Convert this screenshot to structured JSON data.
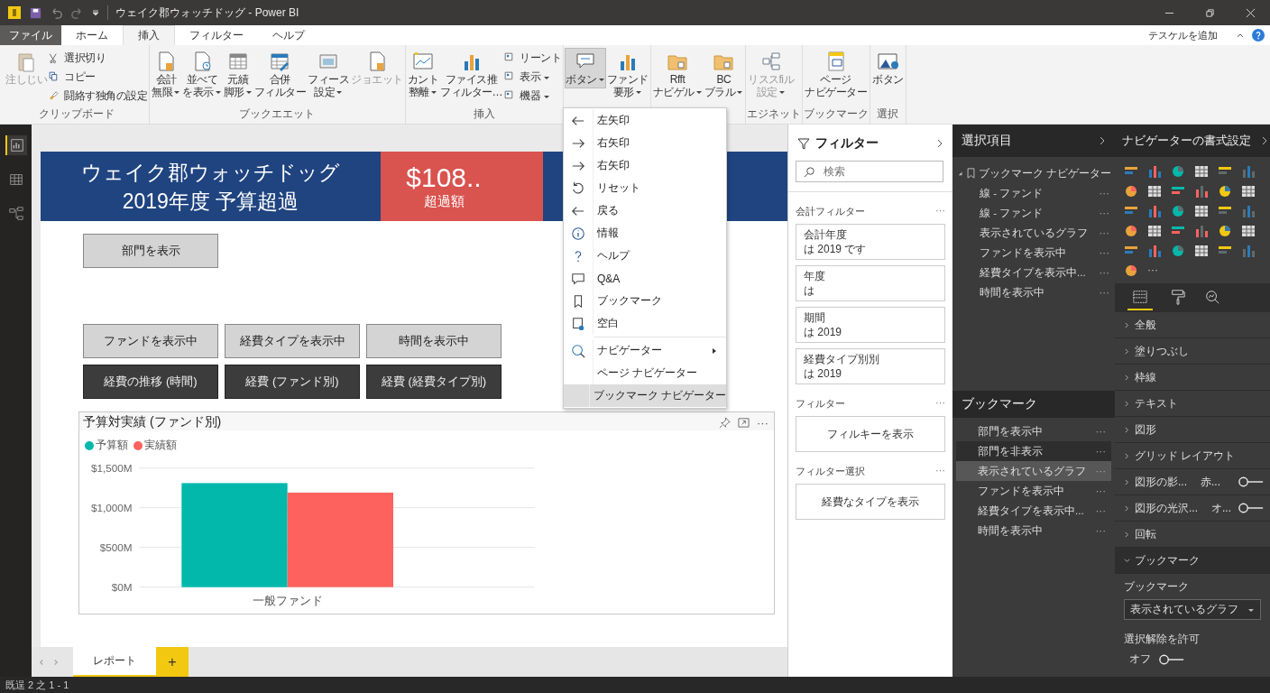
{
  "window": {
    "title": "ウェイク郡ウォッチドッグ - Power BI"
  },
  "tabs": [
    {
      "label": "ファイル",
      "kind": "file",
      "selected": false
    },
    {
      "label": "ホーム",
      "kind": "tab",
      "selected": false
    },
    {
      "label": "挿入",
      "kind": "tab",
      "selected": true
    },
    {
      "label": "フィルター",
      "kind": "tab",
      "selected": false
    },
    {
      "label": "ヘルプ",
      "kind": "tab",
      "selected": false
    }
  ],
  "tab_bar_link": "テスケルを追加",
  "ribbon_groups": [
    {
      "label": "クリップボード",
      "items": [
        {
          "kind": "large",
          "lines": [
            "注しじい"
          ],
          "dropdown": false,
          "disabled": true,
          "pressed": false
        },
        {
          "kind": "stack",
          "entries": [
            {
              "label": "選択切り",
              "dropdown": false
            },
            {
              "label": "コピー",
              "dropdown": false
            },
            {
              "label": "闘絡す独角の設定",
              "dropdown": false
            }
          ]
        }
      ]
    },
    {
      "label": "ブックエエット",
      "items": [
        {
          "kind": "large",
          "lines": [
            "会計",
            "無限"
          ],
          "dropdown": true,
          "disabled": false,
          "pressed": false
        },
        {
          "kind": "large",
          "lines": [
            "並べて",
            "を表示"
          ],
          "dropdown": true,
          "disabled": false,
          "pressed": false
        },
        {
          "kind": "large",
          "lines": [
            "元績",
            "脚形"
          ],
          "dropdown": true,
          "disabled": false,
          "pressed": false
        },
        {
          "kind": "large",
          "lines": [
            "合併",
            "フィルター"
          ],
          "dropdown": false,
          "disabled": false,
          "pressed": false
        },
        {
          "kind": "large",
          "lines": [
            "フィース",
            "設定"
          ],
          "dropdown": true,
          "disabled": false,
          "pressed": false
        },
        {
          "kind": "large",
          "lines": [
            "ジョエット"
          ],
          "dropdown": false,
          "disabled": true,
          "pressed": false
        }
      ]
    },
    {
      "label": "挿入",
      "items": [
        {
          "kind": "large",
          "lines": [
            "カント",
            "整離"
          ],
          "dropdown": true,
          "disabled": false,
          "pressed": false
        },
        {
          "kind": "large",
          "lines": [
            "ファイス推",
            "フィルター…"
          ],
          "dropdown": false,
          "disabled": false,
          "pressed": false
        },
        {
          "kind": "stack",
          "entries": [
            {
              "label": "リーント",
              "dropdown": false
            },
            {
              "label": "表示",
              "dropdown": true
            },
            {
              "label": "機器",
              "dropdown": true
            }
          ]
        }
      ]
    },
    {
      "items": [
        {
          "kind": "large",
          "lines": [
            "ボタン"
          ],
          "dropdown": true,
          "disabled": false,
          "pressed": true
        },
        {
          "kind": "large",
          "lines": [
            "ファンド",
            "要形"
          ],
          "dropdown": true,
          "disabled": false,
          "pressed": false
        }
      ]
    },
    {
      "items": [
        {
          "kind": "large",
          "lines": [
            "Rfft",
            "ナビゲル"
          ],
          "dropdown": true,
          "disabled": false,
          "pressed": false
        },
        {
          "kind": "large",
          "lines": [
            "BC",
            "ブラル"
          ],
          "dropdown": true,
          "disabled": false,
          "pressed": false
        }
      ]
    },
    {
      "label": "エジネット",
      "items": [
        {
          "kind": "large",
          "lines": [
            "リススfiル",
            "設定"
          ],
          "dropdown": true,
          "disabled": true,
          "pressed": false
        }
      ]
    },
    {
      "label": "ブックマーク",
      "items": [
        {
          "kind": "large",
          "lines": [
            "ページ",
            "ナビゲーター"
          ],
          "dropdown": false,
          "disabled": false,
          "pressed": false
        }
      ]
    },
    {
      "label": "選択",
      "items": [
        {
          "kind": "large",
          "lines": [
            "ボタン"
          ],
          "dropdown": false,
          "disabled": false,
          "pressed": false
        }
      ]
    }
  ],
  "rail": [
    {
      "selected": true
    },
    {
      "selected": false
    },
    {
      "selected": false
    }
  ],
  "page": {
    "banner": {
      "title_lines": [
        "ウェイク郡ウォッチドッグ",
        "2019年度 予算超過"
      ],
      "kpi_value": "$108..",
      "kpi_label": "超過額"
    },
    "button_rows": [
      [
        {
          "label": "部門を表示",
          "kind": "light"
        }
      ],
      [
        {
          "label": "ファンドを表示中",
          "kind": "light"
        },
        {
          "label": "経費タイプを表示中",
          "kind": "light"
        },
        {
          "label": "時間を表示中",
          "kind": "light"
        }
      ],
      [
        {
          "label": "経費の推移 (時間)",
          "kind": "dark"
        },
        {
          "label": "経費 (ファンド別)",
          "kind": "dark"
        },
        {
          "label": "経費 (経費タイプ別)",
          "kind": "dark"
        }
      ]
    ],
    "visual": {
      "title": "予算対実績 (ファンド別)",
      "more": "···",
      "chart_data": {
        "type": "bar",
        "categories": [
          "一般ファンド"
        ],
        "series": [
          {
            "name": "予算額",
            "color": "#01b8aa",
            "values": [
              1310
            ]
          },
          {
            "name": "実績額",
            "color": "#fd625e",
            "values": [
              1190
            ]
          }
        ],
        "ylim": [
          0,
          1500
        ],
        "yticks": [
          {
            "value": 0,
            "label": "$0M"
          },
          {
            "value": 500,
            "label": "$500M"
          },
          {
            "value": 1000,
            "label": "$1,000M"
          },
          {
            "value": 1500,
            "label": "$1,500M"
          }
        ]
      }
    }
  },
  "page_tabs": [
    {
      "label": "レポート",
      "selected": true
    }
  ],
  "add_page": "+",
  "status_bar": "既逞 2 之 1 - 1",
  "dropdown_menu": {
    "groups": [
      [
        {
          "label": "左矢印",
          "selected": false,
          "submenu": false
        },
        {
          "label": "右矢印",
          "selected": false,
          "submenu": false
        },
        {
          "label": "右矢印",
          "selected": false,
          "submenu": false
        },
        {
          "label": "リセット",
          "selected": false,
          "submenu": false
        },
        {
          "label": "戻る",
          "selected": false,
          "submenu": false
        },
        {
          "label": "情報",
          "selected": false,
          "submenu": false
        },
        {
          "label": "ヘルプ",
          "selected": false,
          "submenu": false
        },
        {
          "label": "Q&A",
          "selected": false,
          "submenu": false
        },
        {
          "label": "ブックマーク",
          "selected": false,
          "submenu": false
        },
        {
          "label": "空白",
          "selected": false,
          "submenu": false
        }
      ],
      [
        {
          "label": "ナビゲーター",
          "selected": false,
          "submenu": true
        },
        {
          "label": "ページ ナビゲーター",
          "selected": false,
          "submenu": false
        },
        {
          "label": "ブックマーク ナビゲーター",
          "selected": true,
          "submenu": false
        }
      ]
    ]
  },
  "filters": {
    "title": "フィルター",
    "search_placeholder": "検索",
    "sections": [
      {
        "title": "会計フィルター",
        "more": "···",
        "cards": [
          {
            "field": "会計年度",
            "condition": "は 2019 です"
          },
          {
            "field": "年度",
            "condition": "は"
          },
          {
            "field": "期間",
            "condition": "は 2019"
          },
          {
            "field": "経費タイプ別別",
            "condition": "は 2019"
          }
        ]
      },
      {
        "title": "フィルター",
        "more": "···",
        "button": "フィルキーを表示"
      },
      {
        "title": "フィルター選択",
        "more": "···",
        "button": "経費なタイプを表示"
      }
    ]
  },
  "selection": {
    "title": "選択項目",
    "tree": [
      {
        "label": "ブックマーク ナビゲーター",
        "expanded": true,
        "children": [
          {
            "label": "線 - ファンド",
            "more": "···"
          },
          {
            "label": "線 - ファンド",
            "more": "···"
          },
          {
            "label": "表示されているグラフ",
            "more": "···"
          },
          {
            "label": "ファンドを表示中",
            "more": "···"
          },
          {
            "label": "経費タイプを表示中...",
            "more": "···"
          },
          {
            "label": "時間を表示中",
            "more": "···"
          }
        ]
      }
    ],
    "bookmarks_title": "ブックマーク",
    "bookmarks": [
      {
        "label": "部門を表示中",
        "more": "···",
        "selected": false,
        "hovered": false
      },
      {
        "label": "部門を非表示",
        "more": "···",
        "selected": false,
        "hovered": true
      },
      {
        "label": "表示されているグラフ",
        "more": "···",
        "selected": true,
        "hovered": false
      },
      {
        "label": "ファンドを表示中",
        "more": "···",
        "selected": false,
        "hovered": false
      },
      {
        "label": "経費タイプを表示中...",
        "more": "···",
        "selected": false,
        "hovered": false
      },
      {
        "label": "時間を表示中",
        "more": "···",
        "selected": false,
        "hovered": false
      }
    ]
  },
  "format": {
    "title": "ナビゲーターの書式設定",
    "gallery_more": "···",
    "tabs": [
      {
        "selected": true
      },
      {
        "selected": false
      },
      {
        "selected": false
      }
    ],
    "sections": [
      {
        "label": "全般",
        "expanded": false
      },
      {
        "label": "塗りつぶし",
        "expanded": false
      },
      {
        "label": "枠線",
        "expanded": false
      },
      {
        "label": "テキスト",
        "expanded": false
      },
      {
        "label": "図形",
        "expanded": false
      },
      {
        "label": "グリッド レイアウト",
        "expanded": false
      },
      {
        "label": "図形の影...",
        "value": "赤...",
        "toggle_on": false,
        "expanded": false
      },
      {
        "label": "図形の光沢...",
        "value": "オ...",
        "toggle_on": false,
        "expanded": false
      },
      {
        "label": "回転",
        "expanded": false
      },
      {
        "label": "ブックマーク",
        "expanded": true
      }
    ],
    "bookmark_settings": {
      "label": "ブックマーク",
      "dropdown_value": "表示されているグラフ",
      "deselect_label": "選択解除を許可",
      "toggle_label": "オフ",
      "toggle_on": false
    }
  }
}
